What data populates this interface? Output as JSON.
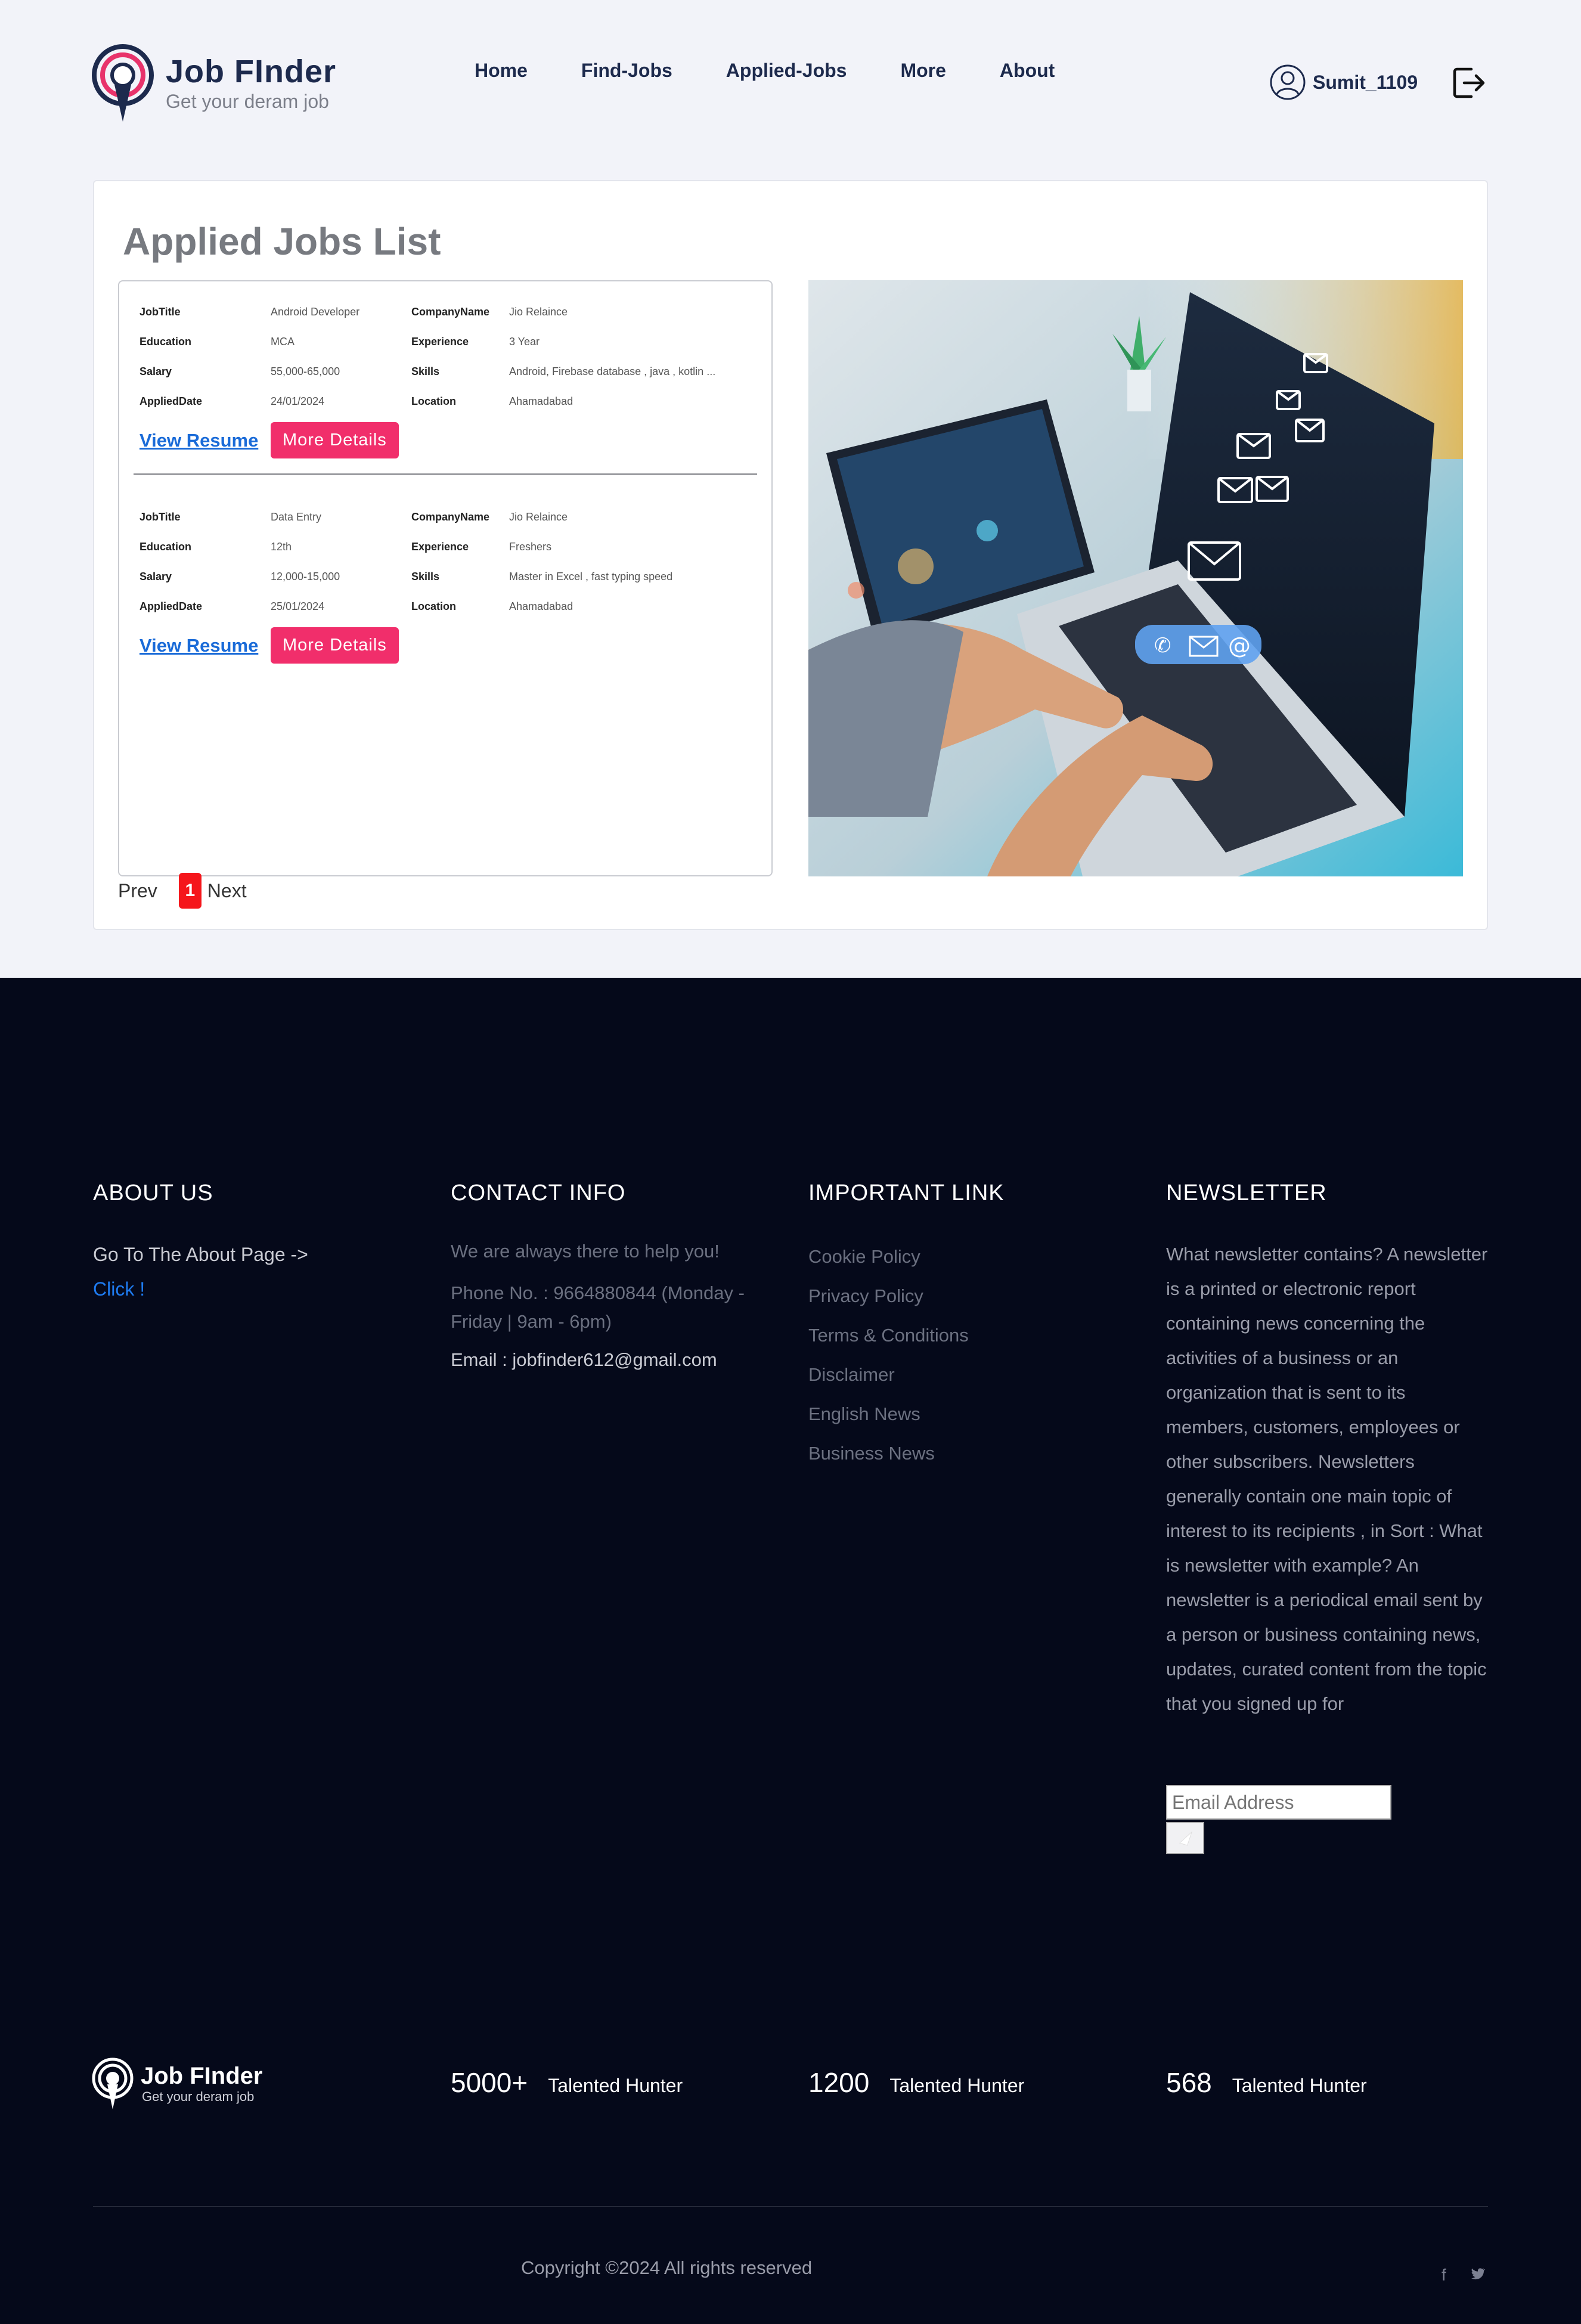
{
  "header": {
    "logo_title": "Job FInder",
    "logo_subtitle": "Get your deram job",
    "nav": [
      "Home",
      "Find-Jobs",
      "Applied-Jobs",
      "More",
      "About"
    ],
    "username": "Sumit_1109"
  },
  "main": {
    "title": "Applied Jobs List",
    "jobs": [
      {
        "job_title_label": "JobTitle",
        "job_title": "Android Developer",
        "company_label": "CompanyName",
        "company": "Jio Relaince",
        "education_label": "Education",
        "education": "MCA",
        "experience_label": "Experience",
        "experience": "3 Year",
        "salary_label": "Salary",
        "salary": "55,000-65,000",
        "skills_label": "Skills",
        "skills": "Android, Firebase database , java , kotlin ...",
        "applied_label": "AppliedDate",
        "applied_date": "24/01/2024",
        "location_label": "Location",
        "location": "Ahamadabad",
        "view_resume": "View Resume",
        "more_details": "More Details"
      },
      {
        "job_title_label": "JobTitle",
        "job_title": "Data Entry",
        "company_label": "CompanyName",
        "company": "Jio Relaince",
        "education_label": "Education",
        "education": "12th",
        "experience_label": "Experience",
        "experience": "Freshers",
        "salary_label": "Salary",
        "salary": "12,000-15,000",
        "skills_label": "Skills",
        "skills": "Master in Excel , fast typing speed",
        "applied_label": "AppliedDate",
        "applied_date": "25/01/2024",
        "location_label": "Location",
        "location": "Ahamadabad",
        "view_resume": "View Resume",
        "more_details": "More Details"
      }
    ],
    "pagination": {
      "prev": "Prev",
      "current": "1",
      "next": "Next"
    }
  },
  "footer": {
    "about": {
      "heading": "ABOUT US",
      "text": "Go To The About Page ->",
      "link": "Click !"
    },
    "contact": {
      "heading": "CONTACT INFO",
      "tagline": "We are always there to help you!",
      "phone": "Phone No. : 9664880844 (Monday - Friday | 9am - 6pm)",
      "email": "Email : jobfinder612@gmail.com"
    },
    "links": {
      "heading": "IMPORTANT LINK",
      "items": [
        "Cookie Policy",
        "Privacy Policy",
        "Terms & Conditions",
        "Disclaimer",
        "English News",
        "Business News"
      ]
    },
    "newsletter": {
      "heading": "NEWSLETTER",
      "text": "What newsletter contains? A newsletter is a printed or electronic report containing news concerning the activities of a business or an organization that is sent to its members, customers, employees or other subscribers. Newsletters generally contain one main topic of interest to its recipients , in Sort : What is newsletter with example? An newsletter is a periodical email sent by a person or business containing news, updates, curated content from the topic that you signed up for",
      "placeholder": "Email Address"
    },
    "logo_title": "Job FInder",
    "logo_subtitle": "Get your deram job",
    "stats": [
      {
        "num": "5000+",
        "label": "Talented Hunter"
      },
      {
        "num": "1200",
        "label": "Talented Hunter"
      },
      {
        "num": "568",
        "label": "Talented Hunter"
      }
    ],
    "copyright": "Copyright ©2024 All rights reserved",
    "social": {
      "facebook": "f",
      "twitter": "🐦"
    }
  },
  "colors": {
    "accent": "#f12e6b",
    "link": "#1a6bd8",
    "footer_bg": "#05091a",
    "nav_text": "#1d2a4d"
  }
}
